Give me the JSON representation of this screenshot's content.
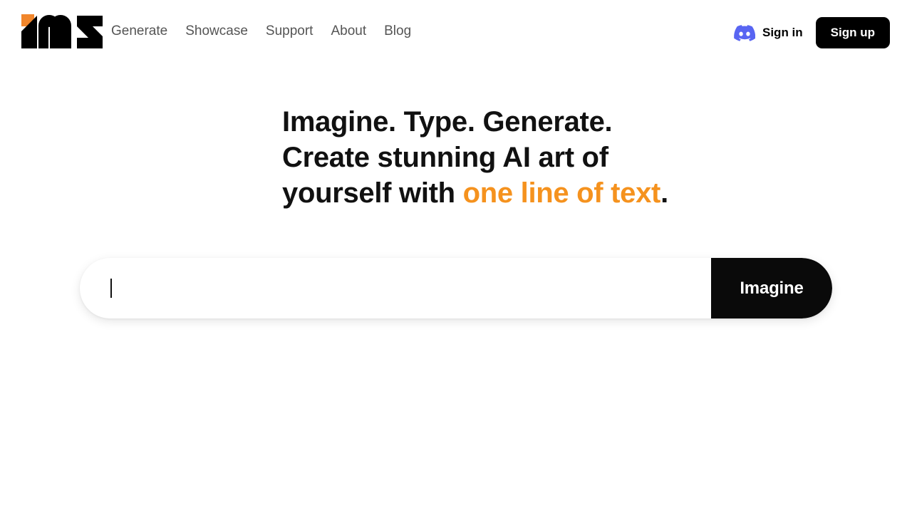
{
  "brand": {
    "name": "mz-logo",
    "accent_color": "#F1862B",
    "mark_color": "#000000"
  },
  "nav": {
    "items": [
      {
        "label": "Generate",
        "name": "nav-link-generate"
      },
      {
        "label": "Showcase",
        "name": "nav-link-showcase"
      },
      {
        "label": "Support",
        "name": "nav-link-support"
      },
      {
        "label": "About",
        "name": "nav-link-about"
      },
      {
        "label": "Blog",
        "name": "nav-link-blog"
      }
    ]
  },
  "header": {
    "discord_icon": "discord-icon",
    "discord_color": "#5865F2",
    "signin_label": "Sign in",
    "signup_label": "Sign up"
  },
  "hero": {
    "headline_line1": "Imagine. Type. Generate.",
    "headline_line2": "Create stunning AI art of",
    "headline_line3_prefix": "yourself with ",
    "headline_accent": "one line of text",
    "headline_suffix": ".",
    "accent_color": "#F5921E"
  },
  "prompt": {
    "value": "",
    "placeholder": "",
    "button_label": "Imagine",
    "button_color": "#0A0A0A"
  }
}
